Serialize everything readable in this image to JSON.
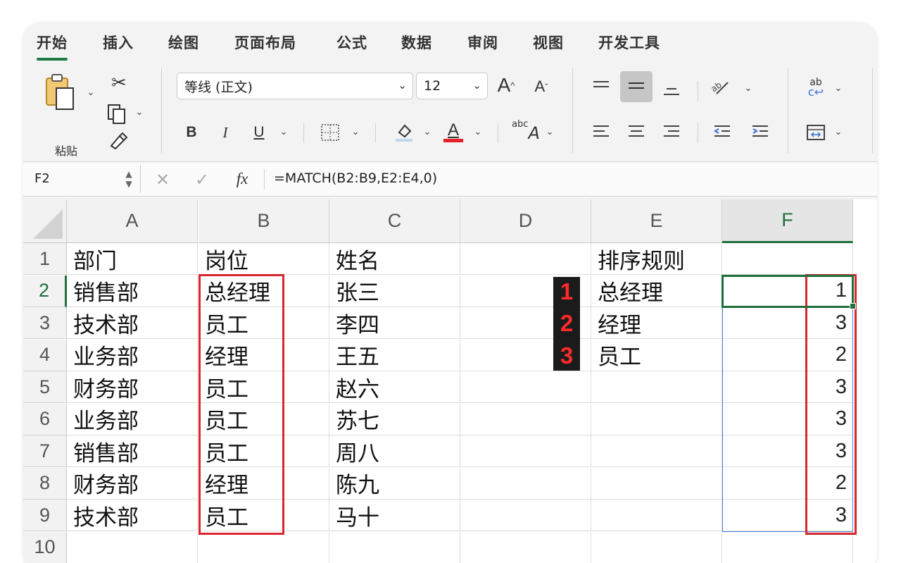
{
  "ribbon_tabs": [
    "开始",
    "插入",
    "绘图",
    "页面布局",
    "公式",
    "数据",
    "审阅",
    "视图",
    "开发工具"
  ],
  "ribbon": {
    "paste_label": "粘贴",
    "font_name": "等线 (正文)",
    "font_size": "12",
    "bold": "B",
    "italic": "I",
    "underline": "U",
    "font_color_letter": "A",
    "grow_font": "A",
    "shrink_font": "A",
    "abc_label": "abc",
    "wrap_label": "ab"
  },
  "formula_bar": {
    "name_box": "F2",
    "fx_label": "fx",
    "formula": "=MATCH(B2:B9,E2:E4,0)"
  },
  "columns": [
    "A",
    "B",
    "C",
    "D",
    "E",
    "F"
  ],
  "rows": [
    "1",
    "2",
    "3",
    "4",
    "5",
    "6",
    "7",
    "8",
    "9",
    "10"
  ],
  "cells": {
    "A": [
      "部门",
      "销售部",
      "技术部",
      "业务部",
      "财务部",
      "业务部",
      "销售部",
      "财务部",
      "技术部",
      ""
    ],
    "B": [
      "岗位",
      "总经理",
      "员工",
      "经理",
      "员工",
      "员工",
      "员工",
      "经理",
      "员工",
      ""
    ],
    "C": [
      "姓名",
      "张三",
      "李四",
      "王五",
      "赵六",
      "苏七",
      "周八",
      "陈九",
      "马十",
      ""
    ],
    "E": [
      "排序规则",
      "总经理",
      "经理",
      "员工",
      "",
      "",
      "",
      "",
      "",
      ""
    ],
    "F": [
      "",
      "1",
      "3",
      "2",
      "3",
      "3",
      "3",
      "2",
      "3",
      ""
    ]
  },
  "badges": [
    "1",
    "2",
    "3"
  ],
  "active_cell": "F2",
  "colors": {
    "accent_green": "#1f6e3c",
    "highlight_red": "#d8262e",
    "range_blue": "#4f7fd6",
    "font_color_bar": "#e8202a"
  }
}
